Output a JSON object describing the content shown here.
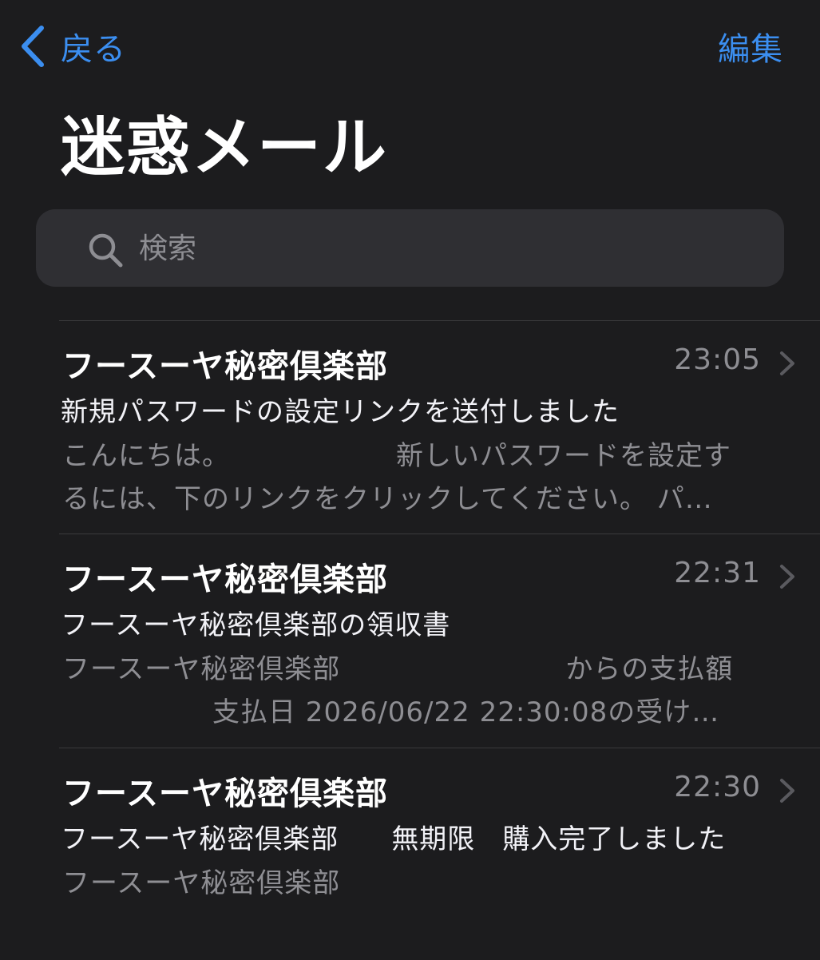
{
  "nav": {
    "back_label": "戻る",
    "edit_label": "編集"
  },
  "title": "迷惑メール",
  "search": {
    "placeholder": "検索"
  },
  "messages": [
    {
      "sender": "フースーヤ秘密倶楽部",
      "time": "23:05",
      "subject": "新規パスワードの設定リンクを送付しました",
      "preview_line1_a": "こんにちは。",
      "preview_line1_b": "新しいパスワードを設定す",
      "preview_line2": "るには、下のリンクをクリックしてください。 パ…"
    },
    {
      "sender": "フースーヤ秘密倶楽部",
      "time": "22:31",
      "subject": "フースーヤ秘密倶楽部の領収書",
      "preview_line1_a": "フースーヤ秘密倶楽部",
      "preview_line1_b": "からの支払額",
      "preview_line2": "支払日 2026/06/22 22:30:08の受け…"
    },
    {
      "sender": "フースーヤ秘密倶楽部",
      "time": "22:30",
      "subject_a": "フースーヤ秘密倶楽部",
      "subject_b": "無期限",
      "subject_c": "購入完了しました",
      "preview_line1": "フースーヤ秘密倶楽部"
    }
  ],
  "colors": {
    "background": "#1c1c1e",
    "accent": "#3b8ef0",
    "secondary_text": "#8e8e93",
    "search_bg": "#2f2f33"
  },
  "icons": {
    "back": "chevron-left-icon",
    "search": "magnifier-icon",
    "disclosure": "chevron-right-icon"
  }
}
